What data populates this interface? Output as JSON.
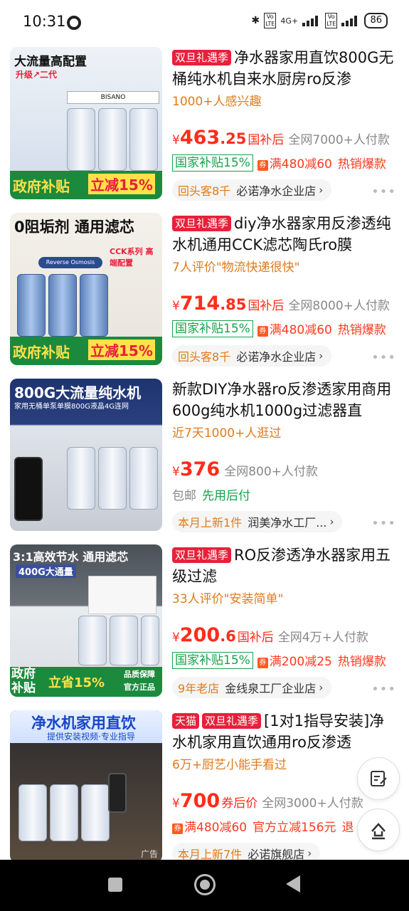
{
  "status": {
    "time": "10:31",
    "network": "4G+",
    "battery": "86"
  },
  "products": [
    {
      "tags": [
        "双旦礼遇季"
      ],
      "title": "净水器家用直饮800G无桶纯水机自来水厨房ro反渗",
      "interest": "1000+人感兴趣",
      "price_int": "463",
      "price_dec": ".25",
      "after_label": "国补后",
      "sold": "全网7000+人付款",
      "subsidy": "国家补贴15%",
      "discount": "满480减60",
      "hot": "热销爆款",
      "shop_tag": "回头客8千",
      "shop_name": "必诺净水企业店",
      "thumb": {
        "headline": "大流量高配置",
        "sub": "升级↗二代",
        "brand": "BISANO",
        "banner_left": "政府补贴",
        "banner_right": "立减15%"
      }
    },
    {
      "tags": [
        "双旦礼遇季"
      ],
      "title": "diy净水器家用反渗透纯水机通用CCK滤芯陶氏ro膜",
      "interest": "7人评价\"物流快递很快\"",
      "price_int": "714",
      "price_dec": ".85",
      "after_label": "国补后",
      "sold": "全网8000+人付款",
      "subsidy": "国家补贴15%",
      "discount": "满480减60",
      "hot": "热销爆款",
      "shop_tag": "回头客8千",
      "shop_name": "必诺净水企业店",
      "thumb": {
        "headline": "0阻垢剂 通用滤芯",
        "sub": "CCK系列 高端配置",
        "brand": "Reverse Osmosis",
        "banner_left": "政府补贴",
        "banner_right": "立减15%"
      }
    },
    {
      "tags": [],
      "title": "新款DIY净水器ro反渗透家用商用600g纯水机1000g过滤器直",
      "interest": "近7天1000+人逛过",
      "price_int": "376",
      "price_dec": "",
      "after_label": "",
      "sold": "全网800+人付款",
      "baoyou": "包邮",
      "xianyong": "先用后付",
      "shop_tag": "本月上新1件",
      "shop_name": "润美净水工厂...",
      "thumb": {
        "headline": "800G大流量纯水机",
        "sub": "家用无桶单泵单膜800G液晶4G连网"
      }
    },
    {
      "tags": [
        "双旦礼遇季"
      ],
      "title": "RO反渗透净水器家用五级过滤",
      "interest": "33人评价\"安装简单\"",
      "price_int": "200",
      "price_dec": ".6",
      "after_label": "国补后",
      "sold": "全网4万+人付款",
      "subsidy": "国家补贴15%",
      "discount": "满200减25",
      "hot": "热销爆款",
      "shop_tag": "9年老店",
      "shop_name": "金线泉工厂企业店",
      "thumb": {
        "headline": "3:1高效节水 通用滤芯",
        "sub": "400G大通量",
        "banner_left": "政府补贴",
        "banner_right": "立省15%",
        "badge": "品质保障 官方正品"
      }
    },
    {
      "tags": [
        "天猫",
        "双旦礼遇季"
      ],
      "title": "[1对1指导安装]净水机家用直饮通用ro反渗透",
      "interest": "6万+厨艺小能手看过",
      "price_int": "700",
      "price_dec": "",
      "after_label": "券后价",
      "sold": "全网3000+人付款",
      "discount": "满480减60",
      "official": "官方立减156元",
      "cut": "退",
      "shop_tag": "本月上新7件",
      "shop_name": "必诺旗舰店",
      "thumb": {
        "headline": "净水机家用直饮",
        "sub": "提供安装视频·专业指导",
        "ad": "广告"
      }
    }
  ]
}
